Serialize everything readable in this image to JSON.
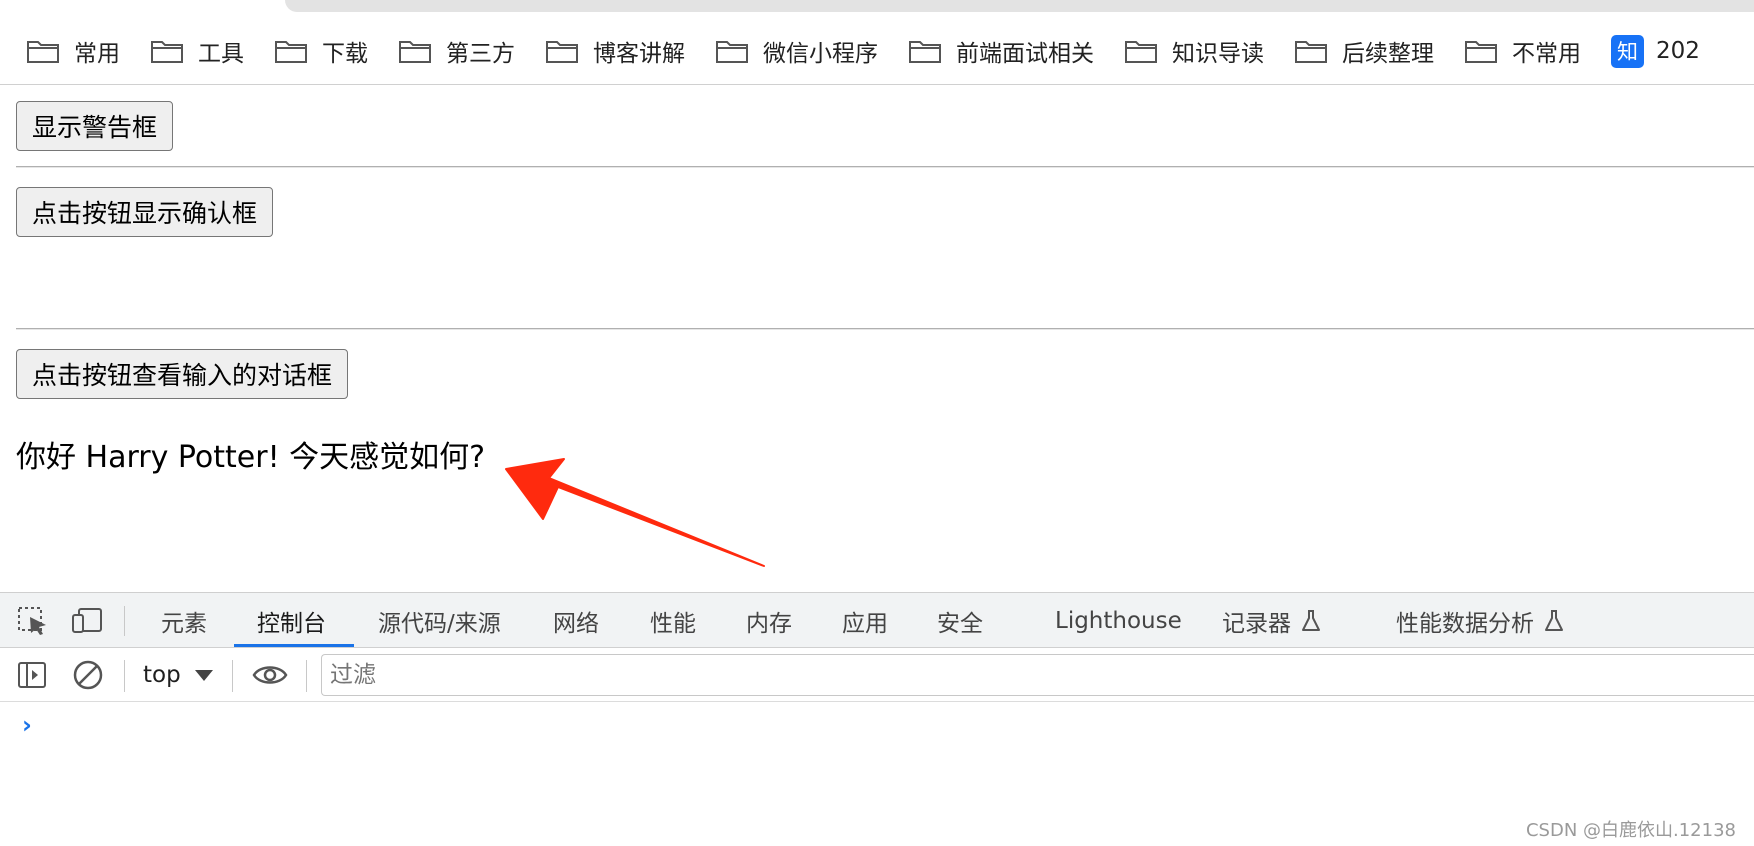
{
  "bookmarks_bar": {
    "items": [
      {
        "label": "常用",
        "icon": "folder-icon"
      },
      {
        "label": "工具",
        "icon": "folder-icon"
      },
      {
        "label": "下载",
        "icon": "folder-icon"
      },
      {
        "label": "第三方",
        "icon": "folder-icon"
      },
      {
        "label": "博客讲解",
        "icon": "folder-icon"
      },
      {
        "label": "微信小程序",
        "icon": "folder-icon"
      },
      {
        "label": "前端面试相关",
        "icon": "folder-icon"
      },
      {
        "label": "知识导读",
        "icon": "folder-icon"
      },
      {
        "label": "后续整理",
        "icon": "folder-icon"
      },
      {
        "label": "不常用",
        "icon": "folder-icon"
      }
    ],
    "zhihu_badge": "知",
    "zhihu_label": "202",
    "zhihu_color": "#1772f6"
  },
  "page": {
    "alert_button": "显示警告框",
    "confirm_button": "点击按钮显示确认框",
    "prompt_button": "点击按钮查看输入的对话框",
    "greeting": "你好 Harry Potter! 今天感觉如何?",
    "arrow_color": "#ff2a0e"
  },
  "devtools": {
    "tabs": [
      "元素",
      "控制台",
      "源代码/来源",
      "网络",
      "性能",
      "内存",
      "应用",
      "安全",
      "Lighthouse",
      "记录器",
      "性能数据分析"
    ],
    "active_tab": "控制台",
    "accent": "#1a73e8",
    "context_selector": "top",
    "filter_placeholder": "过滤",
    "console_prompt": "›"
  },
  "watermark": "CSDN @白鹿依山.12138"
}
